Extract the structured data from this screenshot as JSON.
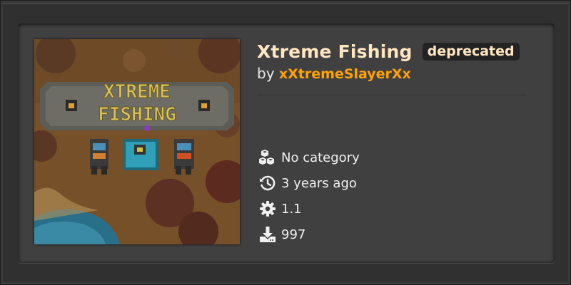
{
  "mod": {
    "title": "Xtreme Fishing",
    "badge": "deprecated",
    "by_prefix": "by",
    "author": "xXtremeSlayerXx",
    "thumbnail_alt": "XTREME FISHING"
  },
  "meta": {
    "category": {
      "icon": "cubes-icon",
      "text": "No category"
    },
    "updated": {
      "icon": "history-icon",
      "text": "3 years ago"
    },
    "version": {
      "icon": "gear-icon",
      "text": "1.1"
    },
    "downloads": {
      "icon": "download-icon",
      "text": "997"
    }
  },
  "colors": {
    "title": "#ffe6c0",
    "author": "#ffa200",
    "card_bg": "#414040",
    "page_bg": "#313031",
    "badge_bg": "#242324"
  }
}
